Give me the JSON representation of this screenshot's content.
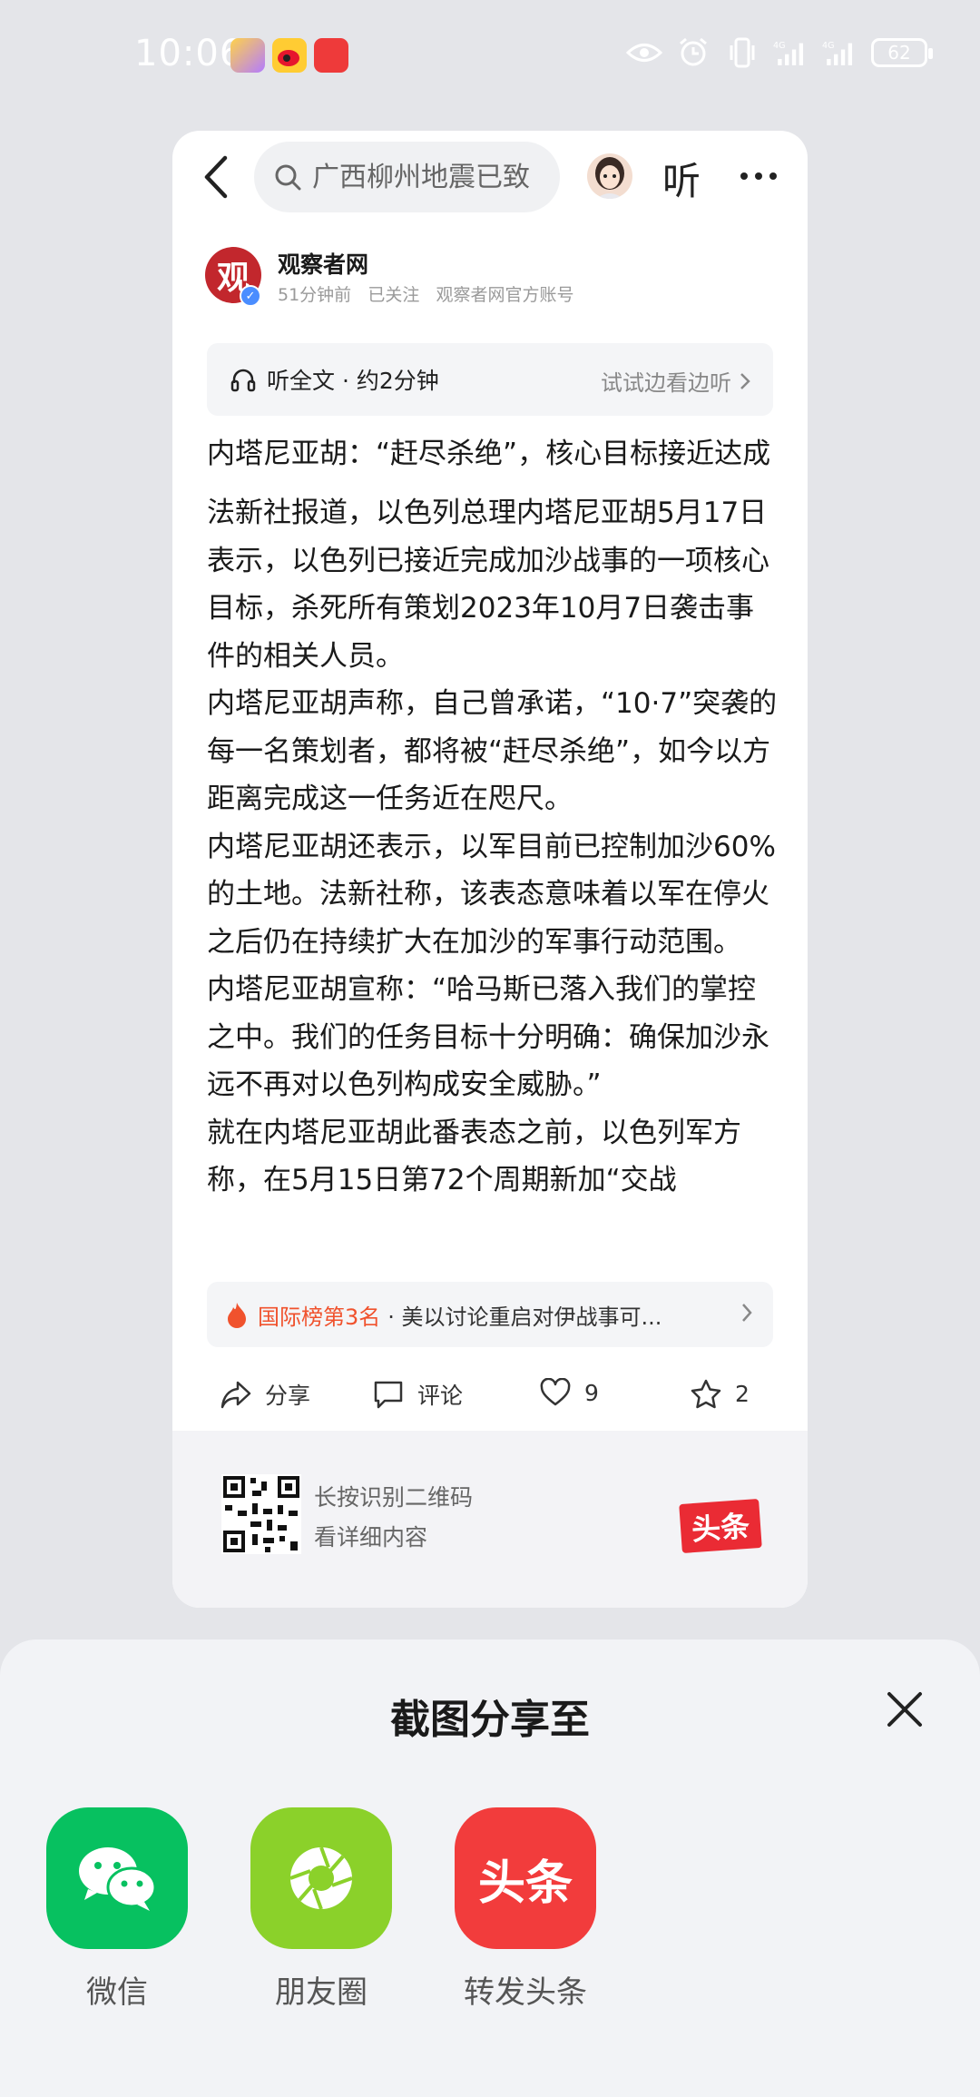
{
  "status_bar": {
    "time": "10:06",
    "battery": "62",
    "network_labels": [
      "4G",
      "4G"
    ]
  },
  "topbar": {
    "search_placeholder": "广西柳州地震已致",
    "listen_label": "听"
  },
  "author": {
    "logo_text": "观",
    "name": "观察者网",
    "time_ago": "51分钟前",
    "follow_status": "已关注",
    "account_desc": "观察者网官方账号"
  },
  "audio": {
    "label": "听全文 · 约2分钟",
    "try_label": "试试边看边听"
  },
  "article": {
    "title": "内塔尼亚胡：“赶尽杀绝”，核心目标接近达成",
    "paragraphs": [
      "法新社报道，以色列总理内塔尼亚胡5月17日表示，以色列已接近完成加沙战事的一项核心目标，杀死所有策划2023年10月7日袭击事件的相关人员。",
      "内塔尼亚胡声称，自己曾承诺，“10·7”突袭的每一名策划者，都将被“赶尽杀绝”，如今以方距离完成这一任务近在咫尺。",
      "内塔尼亚胡还表示，以军目前已控制加沙60%的土地。法新社称，该表态意味着以军在停火之后仍在持续扩大在加沙的军事行动范围。",
      "内塔尼亚胡宣称：“哈马斯已落入我们的掌控之中。我们的任务目标十分明确：确保加沙永远不再对以色列构成安全威胁。”",
      "就在内塔尼亚胡此番表态之前，以色列军方称，在5月15日第72个周期新加“交战"
    ]
  },
  "hot": {
    "rank": "国际榜第3名",
    "headline": "· 美以讨论重启对伊战事可..."
  },
  "actions": {
    "share": "分享",
    "comment": "评论",
    "like_count": "9",
    "favorite_count": "2"
  },
  "qr": {
    "line1": "长按识别二维码",
    "line2": "看详细内容",
    "badge": "头条"
  },
  "sheet": {
    "title": "截图分享至",
    "targets": [
      {
        "label": "微信",
        "color": "#07c160"
      },
      {
        "label": "朋友圈",
        "color": "#8bd12a"
      },
      {
        "label": "转发头条",
        "color": "#f23c3c",
        "tile_text": "头条"
      }
    ]
  }
}
